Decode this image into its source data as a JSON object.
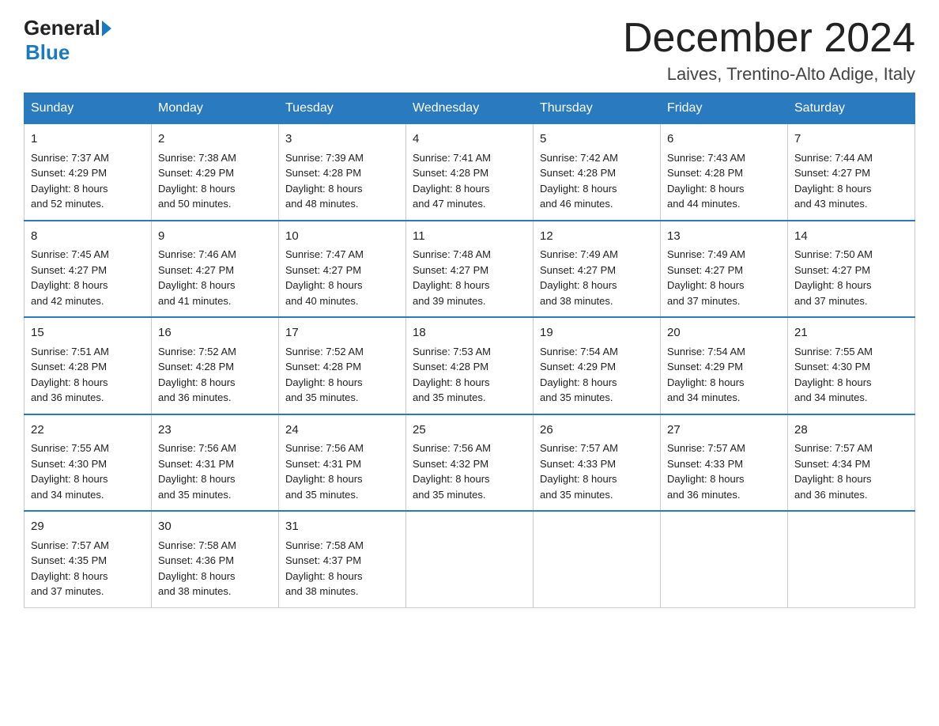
{
  "header": {
    "logo": {
      "general": "General",
      "blue": "Blue",
      "arrow": "▶"
    },
    "title": "December 2024",
    "location": "Laives, Trentino-Alto Adige, Italy"
  },
  "days_of_week": [
    "Sunday",
    "Monday",
    "Tuesday",
    "Wednesday",
    "Thursday",
    "Friday",
    "Saturday"
  ],
  "weeks": [
    [
      {
        "day": "1",
        "sunrise": "7:37 AM",
        "sunset": "4:29 PM",
        "daylight": "8 hours and 52 minutes."
      },
      {
        "day": "2",
        "sunrise": "7:38 AM",
        "sunset": "4:29 PM",
        "daylight": "8 hours and 50 minutes."
      },
      {
        "day": "3",
        "sunrise": "7:39 AM",
        "sunset": "4:28 PM",
        "daylight": "8 hours and 48 minutes."
      },
      {
        "day": "4",
        "sunrise": "7:41 AM",
        "sunset": "4:28 PM",
        "daylight": "8 hours and 47 minutes."
      },
      {
        "day": "5",
        "sunrise": "7:42 AM",
        "sunset": "4:28 PM",
        "daylight": "8 hours and 46 minutes."
      },
      {
        "day": "6",
        "sunrise": "7:43 AM",
        "sunset": "4:28 PM",
        "daylight": "8 hours and 44 minutes."
      },
      {
        "day": "7",
        "sunrise": "7:44 AM",
        "sunset": "4:27 PM",
        "daylight": "8 hours and 43 minutes."
      }
    ],
    [
      {
        "day": "8",
        "sunrise": "7:45 AM",
        "sunset": "4:27 PM",
        "daylight": "8 hours and 42 minutes."
      },
      {
        "day": "9",
        "sunrise": "7:46 AM",
        "sunset": "4:27 PM",
        "daylight": "8 hours and 41 minutes."
      },
      {
        "day": "10",
        "sunrise": "7:47 AM",
        "sunset": "4:27 PM",
        "daylight": "8 hours and 40 minutes."
      },
      {
        "day": "11",
        "sunrise": "7:48 AM",
        "sunset": "4:27 PM",
        "daylight": "8 hours and 39 minutes."
      },
      {
        "day": "12",
        "sunrise": "7:49 AM",
        "sunset": "4:27 PM",
        "daylight": "8 hours and 38 minutes."
      },
      {
        "day": "13",
        "sunrise": "7:49 AM",
        "sunset": "4:27 PM",
        "daylight": "8 hours and 37 minutes."
      },
      {
        "day": "14",
        "sunrise": "7:50 AM",
        "sunset": "4:27 PM",
        "daylight": "8 hours and 37 minutes."
      }
    ],
    [
      {
        "day": "15",
        "sunrise": "7:51 AM",
        "sunset": "4:28 PM",
        "daylight": "8 hours and 36 minutes."
      },
      {
        "day": "16",
        "sunrise": "7:52 AM",
        "sunset": "4:28 PM",
        "daylight": "8 hours and 36 minutes."
      },
      {
        "day": "17",
        "sunrise": "7:52 AM",
        "sunset": "4:28 PM",
        "daylight": "8 hours and 35 minutes."
      },
      {
        "day": "18",
        "sunrise": "7:53 AM",
        "sunset": "4:28 PM",
        "daylight": "8 hours and 35 minutes."
      },
      {
        "day": "19",
        "sunrise": "7:54 AM",
        "sunset": "4:29 PM",
        "daylight": "8 hours and 35 minutes."
      },
      {
        "day": "20",
        "sunrise": "7:54 AM",
        "sunset": "4:29 PM",
        "daylight": "8 hours and 34 minutes."
      },
      {
        "day": "21",
        "sunrise": "7:55 AM",
        "sunset": "4:30 PM",
        "daylight": "8 hours and 34 minutes."
      }
    ],
    [
      {
        "day": "22",
        "sunrise": "7:55 AM",
        "sunset": "4:30 PM",
        "daylight": "8 hours and 34 minutes."
      },
      {
        "day": "23",
        "sunrise": "7:56 AM",
        "sunset": "4:31 PM",
        "daylight": "8 hours and 35 minutes."
      },
      {
        "day": "24",
        "sunrise": "7:56 AM",
        "sunset": "4:31 PM",
        "daylight": "8 hours and 35 minutes."
      },
      {
        "day": "25",
        "sunrise": "7:56 AM",
        "sunset": "4:32 PM",
        "daylight": "8 hours and 35 minutes."
      },
      {
        "day": "26",
        "sunrise": "7:57 AM",
        "sunset": "4:33 PM",
        "daylight": "8 hours and 35 minutes."
      },
      {
        "day": "27",
        "sunrise": "7:57 AM",
        "sunset": "4:33 PM",
        "daylight": "8 hours and 36 minutes."
      },
      {
        "day": "28",
        "sunrise": "7:57 AM",
        "sunset": "4:34 PM",
        "daylight": "8 hours and 36 minutes."
      }
    ],
    [
      {
        "day": "29",
        "sunrise": "7:57 AM",
        "sunset": "4:35 PM",
        "daylight": "8 hours and 37 minutes."
      },
      {
        "day": "30",
        "sunrise": "7:58 AM",
        "sunset": "4:36 PM",
        "daylight": "8 hours and 38 minutes."
      },
      {
        "day": "31",
        "sunrise": "7:58 AM",
        "sunset": "4:37 PM",
        "daylight": "8 hours and 38 minutes."
      },
      null,
      null,
      null,
      null
    ]
  ]
}
